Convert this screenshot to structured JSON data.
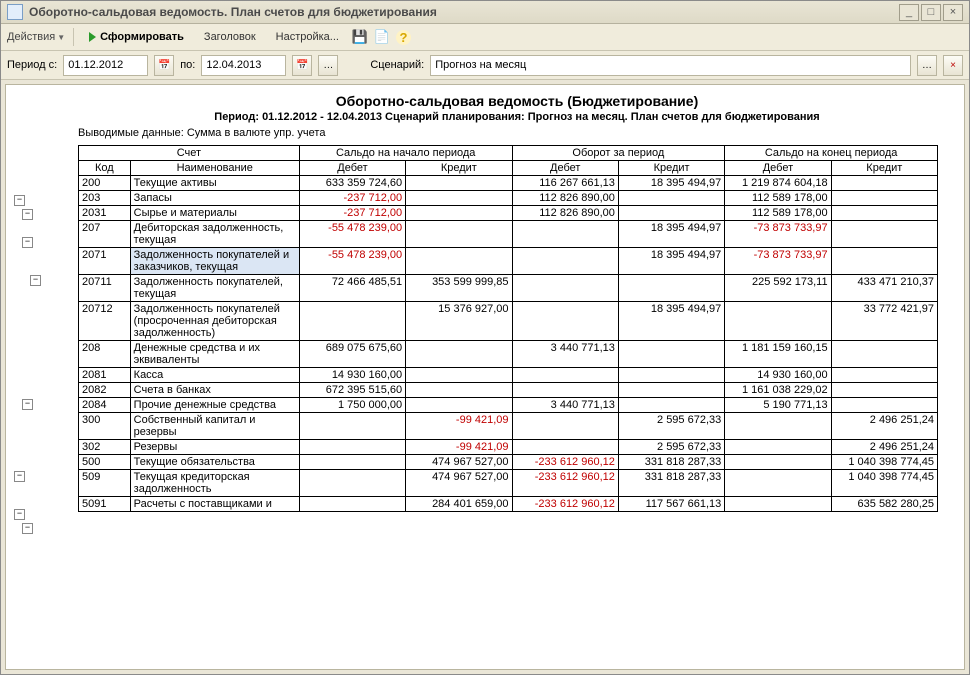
{
  "window": {
    "title": "Оборотно-сальдовая ведомость. План счетов для бюджетирования"
  },
  "toolbar": {
    "actions": "Действия",
    "form": "Сформировать",
    "header": "Заголовок",
    "settings": "Настройка..."
  },
  "params": {
    "period_lbl": "Период с:",
    "date_from": "01.12.2012",
    "to_lbl": "по:",
    "date_to": "12.04.2013",
    "scen_lbl": "Сценарий:",
    "scen_val": "Прогноз на месяц"
  },
  "report": {
    "title": "Оборотно-сальдовая ведомость (Бюджетирование)",
    "subtitle": "Период: 01.12.2012 - 12.04.2013 Сценарий планирования: Прогноз на месяц. План счетов для бюджетирования",
    "note": "Выводимые данные: Сумма в валюте упр. учета",
    "headers": {
      "acct": "Счет",
      "start": "Сальдо на начало периода",
      "turn": "Оборот за период",
      "end": "Сальдо на конец периода",
      "code": "Код",
      "name": "Наименование",
      "debit": "Дебет",
      "credit": "Кредит"
    },
    "rows": [
      {
        "code": "200",
        "name": "Текущие активы",
        "sd": "633 359 724,60",
        "sc": "",
        "td": "116 267 661,13",
        "tc": "18 395 494,97",
        "ed": "1 219 874 604,18",
        "ec": ""
      },
      {
        "code": "203",
        "name": "Запасы",
        "sd": "-237 712,00",
        "sc": "",
        "td": "112 826 890,00",
        "tc": "",
        "ed": "112 589 178,00",
        "ec": "",
        "neg": [
          "sd"
        ]
      },
      {
        "code": "2031",
        "name": "Сырье и материалы",
        "sd": "-237 712,00",
        "sc": "",
        "td": "112 826 890,00",
        "tc": "",
        "ed": "112 589 178,00",
        "ec": "",
        "neg": [
          "sd"
        ]
      },
      {
        "code": "207",
        "name": "Дебиторская задолженность, текущая",
        "sd": "-55 478 239,00",
        "sc": "",
        "td": "",
        "tc": "18 395 494,97",
        "ed": "-73 873 733,97",
        "ec": "",
        "neg": [
          "sd",
          "ed"
        ]
      },
      {
        "code": "2071",
        "name": "Задолженность покупателей и заказчиков, текущая",
        "sd": "-55 478 239,00",
        "sc": "",
        "td": "",
        "tc": "18 395 494,97",
        "ed": "-73 873 733,97",
        "ec": "",
        "neg": [
          "sd",
          "ed"
        ],
        "sel": true
      },
      {
        "code": "20711",
        "name": "Задолженность покупателей, текущая",
        "sd": "72 466 485,51",
        "sc": "353 599 999,85",
        "td": "",
        "tc": "",
        "ed": "225 592 173,11",
        "ec": "433 471 210,37"
      },
      {
        "code": "20712",
        "name": "Задолженность покупателей (просроченная дебиторская задолженность)",
        "sd": "",
        "sc": "15 376 927,00",
        "td": "",
        "tc": "18 395 494,97",
        "ed": "",
        "ec": "33 772 421,97"
      },
      {
        "code": "208",
        "name": "Денежные средства и их эквиваленты",
        "sd": "689 075 675,60",
        "sc": "",
        "td": "3 440 771,13",
        "tc": "",
        "ed": "1 181 159 160,15",
        "ec": ""
      },
      {
        "code": "2081",
        "name": "Касса",
        "sd": "14 930 160,00",
        "sc": "",
        "td": "",
        "tc": "",
        "ed": "14 930 160,00",
        "ec": ""
      },
      {
        "code": "2082",
        "name": "Счета в банках",
        "sd": "672 395 515,60",
        "sc": "",
        "td": "",
        "tc": "",
        "ed": "1 161 038 229,02",
        "ec": ""
      },
      {
        "code": "2084",
        "name": "Прочие денежные средства",
        "sd": "1 750 000,00",
        "sc": "",
        "td": "3 440 771,13",
        "tc": "",
        "ed": "5 190 771,13",
        "ec": ""
      },
      {
        "code": "300",
        "name": "Собственный капитал и резервы",
        "sd": "",
        "sc": "-99 421,09",
        "td": "",
        "tc": "2 595 672,33",
        "ed": "",
        "ec": "2 496 251,24",
        "neg": [
          "sc"
        ]
      },
      {
        "code": "302",
        "name": "Резервы",
        "sd": "",
        "sc": "-99 421,09",
        "td": "",
        "tc": "2 595 672,33",
        "ed": "",
        "ec": "2 496 251,24",
        "neg": [
          "sc"
        ]
      },
      {
        "code": "500",
        "name": "Текущие обязательства",
        "sd": "",
        "sc": "474 967 527,00",
        "td": "-233 612 960,12",
        "tc": "331 818 287,33",
        "ed": "",
        "ec": "1 040 398 774,45",
        "neg": [
          "td"
        ]
      },
      {
        "code": "509",
        "name": "Текущая кредиторская задолженность",
        "sd": "",
        "sc": "474 967 527,00",
        "td": "-233 612 960,12",
        "tc": "331 818 287,33",
        "ed": "",
        "ec": "1 040 398 774,45",
        "neg": [
          "td"
        ]
      },
      {
        "code": "5091",
        "name": "Расчеты с поставщиками и",
        "sd": "",
        "sc": "284 401 659,00",
        "td": "-233 612 960,12",
        "tc": "117 567 661,13",
        "ed": "",
        "ec": "635 582 280,25",
        "neg": [
          "td"
        ]
      }
    ]
  }
}
